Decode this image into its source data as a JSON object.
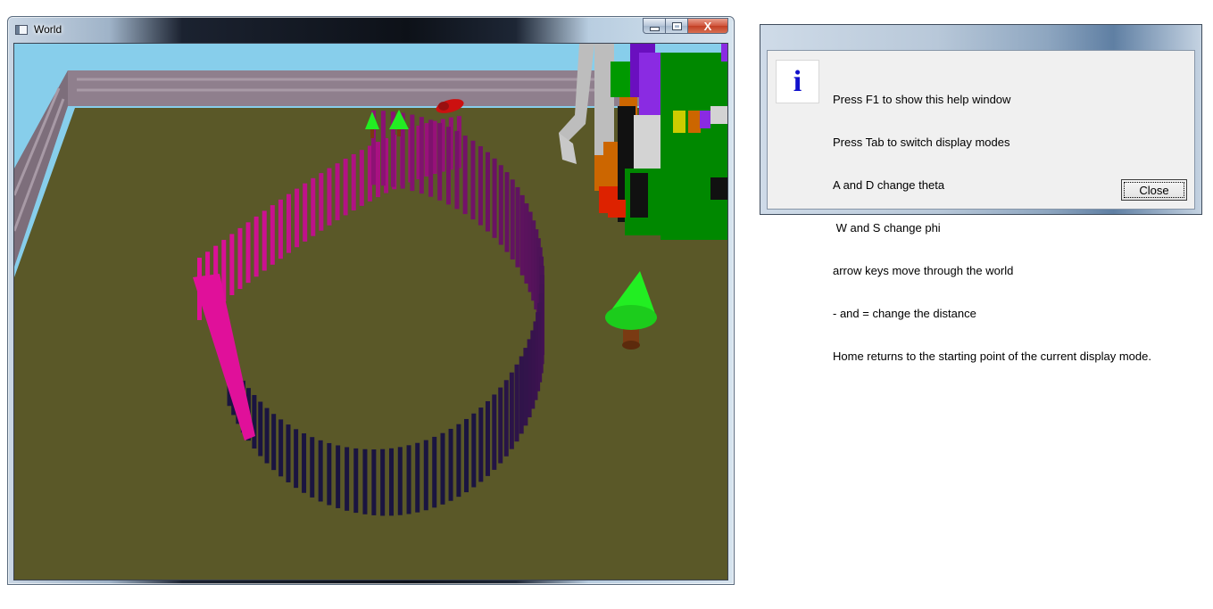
{
  "world_window": {
    "title": "World",
    "caption_buttons": {
      "minimize_icon": "minimize-icon",
      "maximize_icon": "maximize-icon",
      "close_glyph": "X"
    },
    "scene": {
      "description_icons": [
        "roller-coaster-track",
        "coaster-car",
        "tree",
        "block-figure"
      ],
      "colors": {
        "sky": "#87ceeb",
        "ground": "#5a5828",
        "wall": "#8f7f8d",
        "track_start": "#e0109a",
        "track_end": "#1a1440",
        "coaster_car": "#cc1010",
        "tree_foliage": "#22ee22",
        "tree_trunk": "#7a3a12"
      }
    }
  },
  "help_dialog": {
    "icon_glyph": "i",
    "icon_name": "information-icon",
    "lines": [
      "Press F1 to show this help window",
      "Press Tab to switch display modes",
      "A and D change theta",
      " W and S change phi",
      "arrow keys move through the world",
      "- and = change the distance",
      "Home returns to the starting point of the current display mode."
    ],
    "close_label": "Close"
  }
}
